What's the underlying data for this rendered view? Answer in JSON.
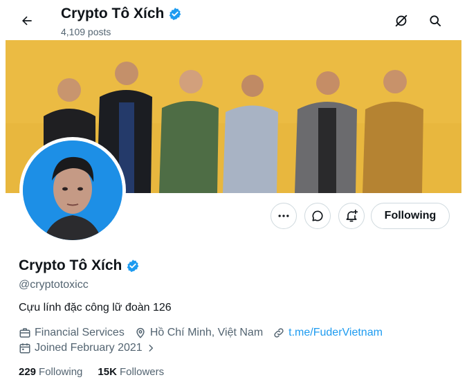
{
  "header": {
    "title": "Crypto Tô Xích",
    "posts_count": "4,109 posts",
    "back_icon": "arrow-left-icon",
    "action_icons": [
      "slash-circle-icon",
      "search-icon"
    ]
  },
  "profile": {
    "name": "Crypto Tô Xích",
    "handle": "@cryptotoxicc",
    "bio": "Cựu lính đặc công lữ đoàn 126",
    "category": "Financial Services",
    "location": "Hồ Chí Minh, Việt Nam",
    "link": "t.me/FuderVietnam",
    "joined": "Joined February 2021",
    "verified_color": "#1d9bf0"
  },
  "actions": {
    "more_icon": "more-dots-icon",
    "message_icon": "message-icon",
    "notify_icon": "bell-plus-icon",
    "following_label": "Following"
  },
  "stats": {
    "following_count": "229",
    "following_label": "Following",
    "followers_count": "15K",
    "followers_label": "Followers"
  },
  "colors": {
    "banner_wall": "#e8b73e",
    "avatar_background": "#1d8fe6",
    "link": "#1d9bf0",
    "secondary_text": "#536471"
  }
}
